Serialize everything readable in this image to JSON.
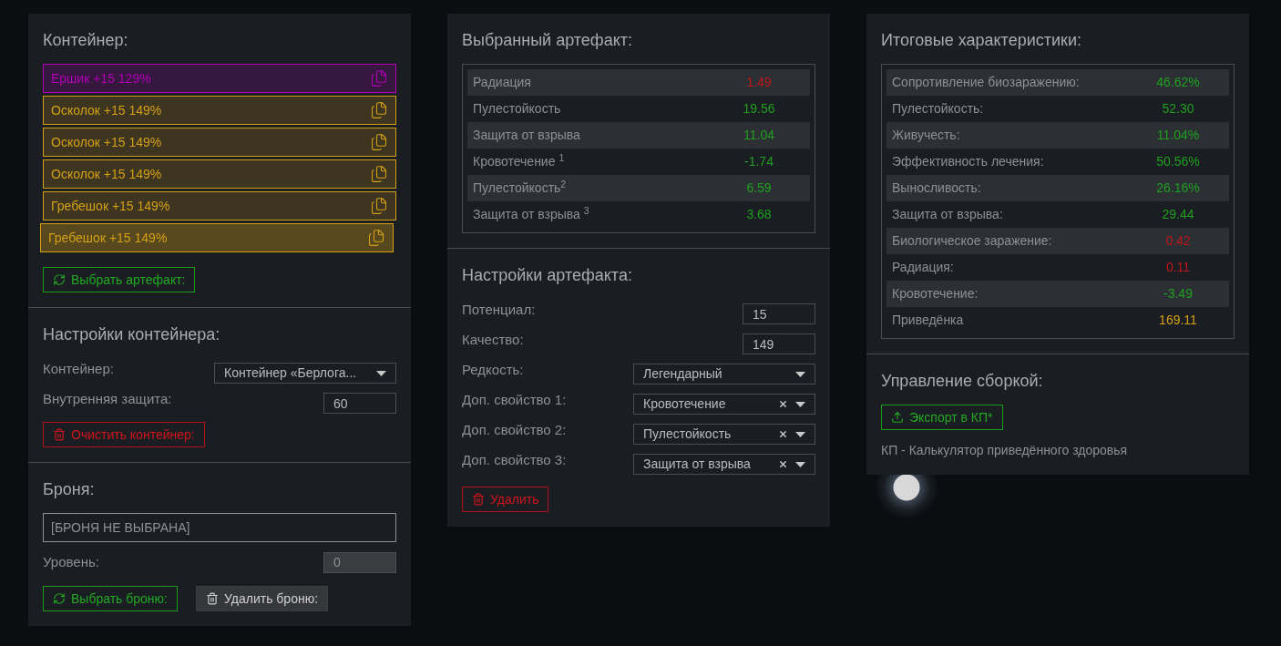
{
  "container_panel": {
    "title": "Контейнер:",
    "artifacts": [
      {
        "name": "Ершик +15 129%",
        "color": "#b000b8",
        "selected": false
      },
      {
        "name": "Осколок +15 149%",
        "color": "#d4a017",
        "selected": false
      },
      {
        "name": "Осколок +15 149%",
        "color": "#d4a017",
        "selected": false
      },
      {
        "name": "Осколок +15 149%",
        "color": "#d4a017",
        "selected": false
      },
      {
        "name": "Гребешок +15 149%",
        "color": "#d4a017",
        "selected": false
      },
      {
        "name": "Гребешок +15 149%",
        "color": "#d4a017",
        "selected": true
      }
    ],
    "pick_button": {
      "label": "Выбрать артефакт:",
      "kind": "success"
    }
  },
  "container_settings": {
    "title": "Настройки контейнера:",
    "fields": [
      {
        "label": "Контейнер:",
        "kind": "select",
        "value": "Контейнер «Берлога..."
      },
      {
        "label": "Внутренняя защита:",
        "kind": "input",
        "value": "60"
      }
    ],
    "clear_button": {
      "label": "Очистить контейнер:",
      "kind": "danger"
    }
  },
  "armor": {
    "title": "Броня:",
    "armor_field": "[БРОНЯ НЕ ВЫБРАНА]",
    "level_label": "Уровень:",
    "level_value": "0",
    "level_disabled": true,
    "buttons": [
      {
        "label": "Выбрать броню:",
        "kind": "success"
      },
      {
        "label": "Удалить броню:",
        "kind": "secondary"
      }
    ]
  },
  "selected_artifact": {
    "title": "Выбранный артефакт:",
    "stats": [
      {
        "name": "Радиация",
        "value": "1.49",
        "color": "#c0161b"
      },
      {
        "name": "Пулестойкость",
        "value": "19.56",
        "color": "#1fa01f"
      },
      {
        "name": "Защита от взрыва",
        "value": "11.04",
        "color": "#1fa01f"
      },
      {
        "name": "Кровотечение $^{1}$",
        "value": "-1.74",
        "color": "#1fa01f"
      },
      {
        "name": "Пулестойкость$^{2}$",
        "value": "6.59",
        "color": "#1fa01f"
      },
      {
        "name": "Защита от взрыва $^{3}$",
        "value": "3.68",
        "color": "#1fa01f"
      }
    ]
  },
  "artifact_settings": {
    "title": "Настройки артефакта:",
    "fields": [
      {
        "label": "Потенциал:",
        "kind": "input",
        "value": "15"
      },
      {
        "label": "Качество:",
        "kind": "input",
        "value": "149"
      },
      {
        "label": "Редкость:",
        "kind": "select",
        "value": "Легендарный",
        "clearable": false
      },
      {
        "label": "Доп. свойство 1:",
        "kind": "select",
        "value": "Кровотечение",
        "clearable": true
      },
      {
        "label": "Доп. свойство 2:",
        "kind": "select",
        "value": "Пулестойкость",
        "clearable": true
      },
      {
        "label": "Доп. свойство 3:",
        "kind": "select",
        "value": "Защита от взрыва",
        "clearable": true
      }
    ],
    "delete_button": {
      "label": "Удалить",
      "kind": "danger"
    }
  },
  "totals": {
    "title": "Итоговые характеристики:",
    "stats": [
      {
        "name": "Сопротивление биозаражению:",
        "value": "46.62%",
        "color": "#1fa01f"
      },
      {
        "name": "Пулестойкость:",
        "value": "52.30",
        "color": "#1fa01f"
      },
      {
        "name": "Живучесть:",
        "value": "11.04%",
        "color": "#1fa01f"
      },
      {
        "name": "Эффективность лечения:",
        "value": "50.56%",
        "color": "#1fa01f"
      },
      {
        "name": "Выносливость:",
        "value": "26.16%",
        "color": "#1fa01f"
      },
      {
        "name": "Защита от взрыва:",
        "value": "29.44",
        "color": "#1fa01f"
      },
      {
        "name": "Биологическое заражение:",
        "value": "0.42",
        "color": "#c0161b"
      },
      {
        "name": "Радиация:",
        "value": "0.11",
        "color": "#c0161b"
      },
      {
        "name": "Кровотечение:",
        "value": "-3.49",
        "color": "#1fa01f"
      },
      {
        "name": "Приведёнка",
        "value": "169.11",
        "color": "#d4a017"
      }
    ]
  },
  "build": {
    "title": "Управление сборкой:",
    "export_button": {
      "label": "Экспорт в КП*",
      "kind": "success"
    },
    "note": "КП - Калькулятор приведённого здоровья"
  }
}
